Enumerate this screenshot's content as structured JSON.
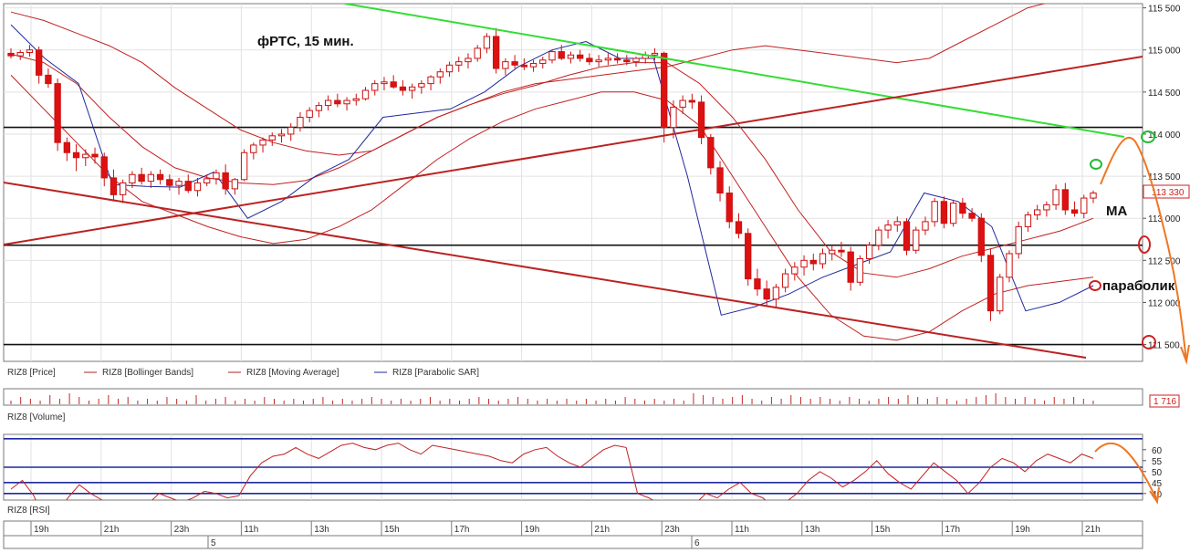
{
  "chart_data": [
    {
      "type": "candlestick",
      "title": "фРТС, 15 мин.",
      "instrument": "RIZ8",
      "y_ticks": [
        "115 500",
        "115 000",
        "114 500",
        "114 000",
        "113 500",
        "113 000",
        "112 500",
        "112 000",
        "111 500"
      ],
      "y_tick_values": [
        115500,
        115000,
        114500,
        114000,
        113500,
        113000,
        112500,
        112000,
        111500
      ],
      "ylim": [
        111300,
        115550
      ],
      "last_price_label": "113 330",
      "legend": [
        {
          "label": "RIZ8 [Price]",
          "color": "#cc0000",
          "style": "bar"
        },
        {
          "label": "RIZ8 [Bollinger Bands]",
          "color": "#b22222",
          "style": "line"
        },
        {
          "label": "RIZ8 [Moving Average]",
          "color": "#b22222",
          "style": "line"
        },
        {
          "label": "RIZ8 [Parabolic SAR]",
          "color": "#1e2a9c",
          "style": "line"
        }
      ],
      "annotations": [
        {
          "text": "MA",
          "type": "label"
        },
        {
          "text": "параболик",
          "type": "label"
        }
      ],
      "levels": [
        114080,
        112680,
        111500
      ],
      "candles": [
        [
          114960,
          115020,
          114900,
          114930
        ],
        [
          114930,
          115000,
          114880,
          114970
        ],
        [
          114970,
          115060,
          114920,
          115000
        ],
        [
          115000,
          115040,
          114600,
          114700
        ],
        [
          114700,
          114780,
          114550,
          114600
        ],
        [
          114600,
          114660,
          113800,
          113900
        ],
        [
          113900,
          113960,
          113680,
          113780
        ],
        [
          113780,
          113880,
          113560,
          113720
        ],
        [
          113720,
          113820,
          113620,
          113760
        ],
        [
          113760,
          113840,
          113650,
          113730
        ],
        [
          113730,
          113780,
          113380,
          113480
        ],
        [
          113480,
          113580,
          113200,
          113280
        ],
        [
          113280,
          113460,
          113180,
          113420
        ],
        [
          113420,
          113560,
          113360,
          113520
        ],
        [
          113520,
          113600,
          113400,
          113440
        ],
        [
          113440,
          113560,
          113360,
          113520
        ],
        [
          113520,
          113580,
          113400,
          113460
        ],
        [
          113460,
          113520,
          113330,
          113390
        ],
        [
          113390,
          113480,
          113280,
          113440
        ],
        [
          113440,
          113520,
          113300,
          113330
        ],
        [
          113330,
          113480,
          113260,
          113420
        ],
        [
          113420,
          113520,
          113380,
          113470
        ],
        [
          113470,
          113580,
          113400,
          113540
        ],
        [
          113540,
          113640,
          113280,
          113350
        ],
        [
          113350,
          113480,
          113280,
          113460
        ],
        [
          113460,
          113820,
          113440,
          113780
        ],
        [
          113780,
          113900,
          113700,
          113870
        ],
        [
          113870,
          113960,
          113780,
          113930
        ],
        [
          113930,
          114020,
          113860,
          113980
        ],
        [
          113980,
          114060,
          113900,
          114000
        ],
        [
          114000,
          114130,
          113920,
          114080
        ],
        [
          114080,
          114260,
          114030,
          114200
        ],
        [
          114200,
          114320,
          114140,
          114280
        ],
        [
          114280,
          114380,
          114200,
          114340
        ],
        [
          114340,
          114460,
          114280,
          114400
        ],
        [
          114400,
          114480,
          114320,
          114360
        ],
        [
          114360,
          114440,
          114280,
          114400
        ],
        [
          114400,
          114480,
          114340,
          114420
        ],
        [
          114420,
          114560,
          114400,
          114520
        ],
        [
          114520,
          114640,
          114460,
          114600
        ],
        [
          114600,
          114680,
          114520,
          114620
        ],
        [
          114620,
          114700,
          114540,
          114560
        ],
        [
          114560,
          114640,
          114460,
          114520
        ],
        [
          114520,
          114600,
          114420,
          114560
        ],
        [
          114560,
          114640,
          114480,
          114600
        ],
        [
          114600,
          114700,
          114520,
          114680
        ],
        [
          114680,
          114780,
          114600,
          114740
        ],
        [
          114740,
          114860,
          114680,
          114820
        ],
        [
          114820,
          114920,
          114740,
          114860
        ],
        [
          114860,
          114960,
          114780,
          114900
        ],
        [
          114900,
          115060,
          114860,
          115020
        ],
        [
          115020,
          115200,
          114960,
          115160
        ],
        [
          115160,
          115260,
          114720,
          114780
        ],
        [
          114780,
          114900,
          114700,
          114860
        ],
        [
          114860,
          114940,
          114780,
          114820
        ],
        [
          114820,
          114900,
          114760,
          114800
        ],
        [
          114800,
          114880,
          114740,
          114840
        ],
        [
          114840,
          114920,
          114780,
          114880
        ],
        [
          114880,
          115000,
          114840,
          114980
        ],
        [
          114980,
          115060,
          114880,
          114900
        ],
        [
          114900,
          114980,
          114840,
          114940
        ],
        [
          114940,
          115000,
          114860,
          114900
        ],
        [
          114900,
          114960,
          114820,
          114860
        ],
        [
          114860,
          114940,
          114800,
          114880
        ],
        [
          114880,
          114960,
          114820,
          114900
        ],
        [
          114900,
          114960,
          114840,
          114880
        ],
        [
          114880,
          114940,
          114820,
          114860
        ],
        [
          114860,
          114920,
          114800,
          114900
        ],
        [
          114900,
          114980,
          114840,
          114940
        ],
        [
          114940,
          115020,
          114880,
          114960
        ],
        [
          114960,
          114980,
          113900,
          114080
        ],
        [
          114080,
          114400,
          113950,
          114320
        ],
        [
          114320,
          114460,
          114240,
          114400
        ],
        [
          114400,
          114480,
          114300,
          114380
        ],
        [
          114380,
          114460,
          113880,
          113960
        ],
        [
          113960,
          114000,
          113520,
          113600
        ],
        [
          113600,
          113680,
          113200,
          113300
        ],
        [
          113300,
          113380,
          112880,
          112960
        ],
        [
          112960,
          113060,
          112760,
          112820
        ],
        [
          112820,
          112880,
          112200,
          112280
        ],
        [
          112280,
          112400,
          112080,
          112160
        ],
        [
          112160,
          112260,
          111960,
          112040
        ],
        [
          112040,
          112220,
          111940,
          112180
        ],
        [
          112180,
          112400,
          112120,
          112340
        ],
        [
          112340,
          112480,
          112260,
          112420
        ],
        [
          112420,
          112560,
          112320,
          112500
        ],
        [
          112500,
          112580,
          112380,
          112460
        ],
        [
          112460,
          112640,
          112400,
          112580
        ],
        [
          112580,
          112680,
          112500,
          112620
        ],
        [
          112620,
          112720,
          112540,
          112600
        ],
        [
          112600,
          112660,
          112140,
          112240
        ],
        [
          112240,
          112560,
          112200,
          112520
        ],
        [
          112520,
          112720,
          112460,
          112680
        ],
        [
          112680,
          112900,
          112620,
          112860
        ],
        [
          112860,
          112980,
          112760,
          112920
        ],
        [
          112920,
          113020,
          112840,
          112960
        ],
        [
          112960,
          113000,
          112560,
          112620
        ],
        [
          112620,
          112900,
          112580,
          112860
        ],
        [
          112860,
          113020,
          112800,
          112960
        ],
        [
          112960,
          113240,
          112900,
          113200
        ],
        [
          113200,
          113260,
          112880,
          112940
        ],
        [
          112940,
          113220,
          112900,
          113180
        ],
        [
          113180,
          113240,
          113000,
          113060
        ],
        [
          113060,
          113120,
          112960,
          113000
        ],
        [
          113000,
          113060,
          112480,
          112560
        ],
        [
          112560,
          112640,
          111780,
          111900
        ],
        [
          111900,
          112340,
          111860,
          112300
        ],
        [
          112300,
          112620,
          112240,
          112580
        ],
        [
          112580,
          112960,
          112520,
          112900
        ],
        [
          112900,
          113080,
          112840,
          113040
        ],
        [
          113040,
          113160,
          112980,
          113100
        ],
        [
          113100,
          113200,
          113020,
          113160
        ],
        [
          113160,
          113400,
          113100,
          113340
        ],
        [
          113340,
          113420,
          113040,
          113100
        ],
        [
          113100,
          113200,
          113020,
          113060
        ],
        [
          113060,
          113280,
          113000,
          113240
        ],
        [
          113240,
          113330,
          113180,
          113300
        ]
      ],
      "bollinger_upper": [
        115450,
        115350,
        115200,
        115050,
        114850,
        114550,
        114300,
        114050,
        113900,
        113800,
        113750,
        113800,
        114000,
        114200,
        114350,
        114500,
        114600,
        114650,
        114700,
        114750,
        114800,
        114900,
        115000,
        115050,
        115000,
        114950,
        114900,
        114850,
        114900,
        115100,
        115300,
        115500,
        115600,
        115700
      ],
      "bollinger_lower": [
        114700,
        114300,
        113900,
        113500,
        113200,
        113050,
        112900,
        112780,
        112700,
        112750,
        112900,
        113100,
        113400,
        113700,
        113950,
        114150,
        114300,
        114400,
        114500,
        114500,
        114400,
        114100,
        113500,
        112900,
        112300,
        111850,
        111600,
        111550,
        111650,
        111900,
        112100,
        112200,
        112250,
        112300
      ],
      "moving_average": [
        114950,
        114850,
        114600,
        114200,
        113850,
        113600,
        113480,
        113420,
        113400,
        113450,
        113600,
        113800,
        114000,
        114200,
        114350,
        114480,
        114580,
        114700,
        114800,
        114850,
        114850,
        114600,
        114200,
        113700,
        113100,
        112600,
        112350,
        112300,
        112400,
        112550,
        112650,
        112750,
        112850,
        113000
      ],
      "parabolic_sar": [
        115300,
        114900,
        114600,
        113400,
        113380,
        113370,
        113550,
        113000,
        113200,
        113500,
        113700,
        114200,
        114250,
        114300,
        114500,
        114800,
        115000,
        115100,
        114900,
        114900,
        113500,
        111850,
        111950,
        112100,
        112300,
        112450,
        112600,
        113300,
        113200,
        112900,
        111900,
        112000,
        112200
      ],
      "volume": {
        "label": "RIZ8 [Volume]",
        "value_label": "1 716",
        "bars": [
          2,
          4,
          3,
          2,
          5,
          3,
          6,
          4,
          2,
          3,
          5,
          3,
          4,
          2,
          3,
          2,
          4,
          3,
          2,
          5,
          2,
          3,
          4,
          2,
          3,
          2,
          4,
          3,
          2,
          3,
          2,
          3,
          4,
          2,
          3,
          2,
          3,
          4,
          3,
          2,
          3,
          2,
          3,
          4,
          2,
          3,
          2,
          3,
          4,
          3,
          2,
          3,
          4,
          3,
          2,
          3,
          2,
          3,
          2,
          3,
          2,
          3,
          2,
          4,
          3,
          2,
          3,
          2,
          3,
          2,
          6,
          5,
          4,
          3,
          4,
          5,
          3,
          2,
          4,
          3,
          5,
          4,
          3,
          4,
          3,
          2,
          4,
          3,
          2,
          3,
          4,
          3,
          5,
          4,
          3,
          4,
          3,
          2,
          3,
          4,
          5,
          6,
          4,
          3,
          4,
          3,
          2,
          4,
          3,
          4,
          3,
          2
        ]
      },
      "rsi": {
        "label": "RIZ8 [RSI]",
        "y_ticks": [
          "60",
          "55",
          "50",
          "45",
          "40"
        ],
        "y_tick_values": [
          60,
          55,
          50,
          45,
          40
        ],
        "levels": [
          65,
          52,
          45,
          40
        ],
        "values": [
          42,
          46,
          39,
          27,
          30,
          38,
          44,
          40,
          37,
          34,
          33,
          30,
          35,
          40,
          38,
          36,
          38,
          41,
          40,
          38,
          39,
          48,
          54,
          57,
          58,
          61,
          58,
          56,
          59,
          62,
          63,
          61,
          60,
          62,
          63,
          60,
          58,
          62,
          61,
          60,
          59,
          58,
          57,
          55,
          54,
          58,
          60,
          61,
          57,
          54,
          52,
          56,
          60,
          62,
          61,
          40,
          38,
          35,
          32,
          30,
          35,
          40,
          38,
          42,
          45,
          40,
          38,
          33,
          36,
          40,
          46,
          50,
          47,
          43,
          46,
          50,
          55,
          49,
          45,
          42,
          48,
          54,
          50,
          46,
          40,
          45,
          52,
          56,
          54,
          50,
          55,
          58,
          56,
          54,
          58,
          56
        ]
      },
      "time_axis": {
        "hours": [
          "19h",
          "21h",
          "23h",
          "11h",
          "13h",
          "15h",
          "17h",
          "19h",
          "21h",
          "23h",
          "11h",
          "13h",
          "15h",
          "17h",
          "19h",
          "21h"
        ],
        "days": [
          "5",
          "6"
        ]
      }
    }
  ]
}
